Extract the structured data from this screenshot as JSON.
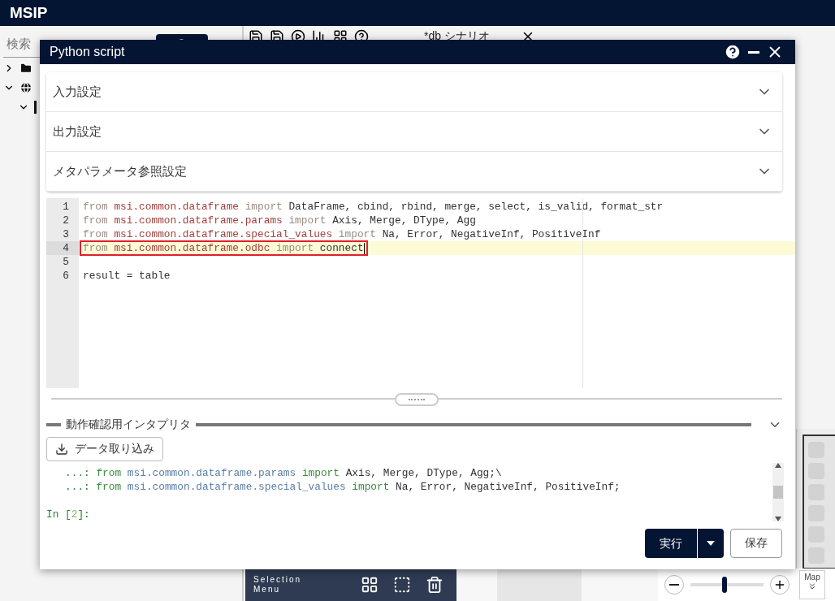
{
  "app": {
    "title": "MSIP"
  },
  "sidebar": {
    "search_placeholder": "検索",
    "tree": [
      {
        "expanded": false
      },
      {
        "expanded": true,
        "children": [
          {
            "expanded": true
          }
        ]
      }
    ]
  },
  "editor_tab": {
    "label": "*db シナリオ"
  },
  "dialog": {
    "title": "Python script",
    "sections": [
      {
        "label": "入力設定",
        "expanded": false
      },
      {
        "label": "出力設定",
        "expanded": false
      },
      {
        "label": "メタパラメータ参照設定",
        "expanded": false
      }
    ],
    "code_lines": [
      {
        "number": "1",
        "highlighted": false,
        "tokens": [
          {
            "kind": "kw",
            "text": "from"
          },
          {
            "kind": "module",
            "text": " msi.common.dataframe"
          },
          {
            "kind": "kw",
            "text": " import"
          },
          {
            "kind": "plain",
            "text": " DataFrame, cbind, rbind, merge, select, is_valid, format_str"
          }
        ]
      },
      {
        "number": "2",
        "highlighted": false,
        "tokens": [
          {
            "kind": "kw",
            "text": "from"
          },
          {
            "kind": "module",
            "text": " msi.common.dataframe.params"
          },
          {
            "kind": "kw",
            "text": " import"
          },
          {
            "kind": "plain",
            "text": " Axis, Merge, DType, Agg"
          }
        ]
      },
      {
        "number": "3",
        "highlighted": false,
        "tokens": [
          {
            "kind": "kw",
            "text": "from"
          },
          {
            "kind": "module",
            "text": " msi.common.dataframe.special_values"
          },
          {
            "kind": "kw",
            "text": " import"
          },
          {
            "kind": "plain",
            "text": " Na, Error, NegativeInf, PositiveInf"
          }
        ]
      },
      {
        "number": "4",
        "highlighted": true,
        "outlined": true,
        "tokens": [
          {
            "kind": "kw",
            "text": "from"
          },
          {
            "kind": "module",
            "text": " msi.common.dataframe.odbc"
          },
          {
            "kind": "kw",
            "text": " import"
          },
          {
            "kind": "plain",
            "text": " connect"
          }
        ]
      },
      {
        "number": "5",
        "highlighted": false
      },
      {
        "number": "6",
        "highlighted": false,
        "tokens": [
          {
            "kind": "plain",
            "text": "result = table"
          }
        ]
      }
    ],
    "interpreter": {
      "legend": "動作確認用インタプリタ",
      "import_button": "データ取り込み",
      "expanded": true,
      "lines": [
        [
          {
            "kind": "prompt",
            "text": "   ...:"
          },
          {
            "kind": "kw",
            "text": " from"
          },
          {
            "kind": "module",
            "text": " msi.common.dataframe.params"
          },
          {
            "kind": "kw",
            "text": " import"
          },
          {
            "kind": "plain",
            "text": " Axis, Merge, DType, Agg;\\"
          }
        ],
        [
          {
            "kind": "prompt",
            "text": "   ...:"
          },
          {
            "kind": "kw",
            "text": " from"
          },
          {
            "kind": "module",
            "text": " msi.common.dataframe.special_values"
          },
          {
            "kind": "kw",
            "text": " import"
          },
          {
            "kind": "plain",
            "text": " Na, Error, NegativeInf, PositiveInf;"
          }
        ],
        [
          {
            "kind": "prompt",
            "text": "In ["
          },
          {
            "kind": "number",
            "text": "2"
          },
          {
            "kind": "prompt",
            "text": "]:"
          }
        ]
      ]
    },
    "run_button": "実行",
    "save_button": "保存"
  },
  "selection_menu": {
    "label": "Selection Menu"
  },
  "map_controls": {
    "label": "Map",
    "level": 0.47
  }
}
